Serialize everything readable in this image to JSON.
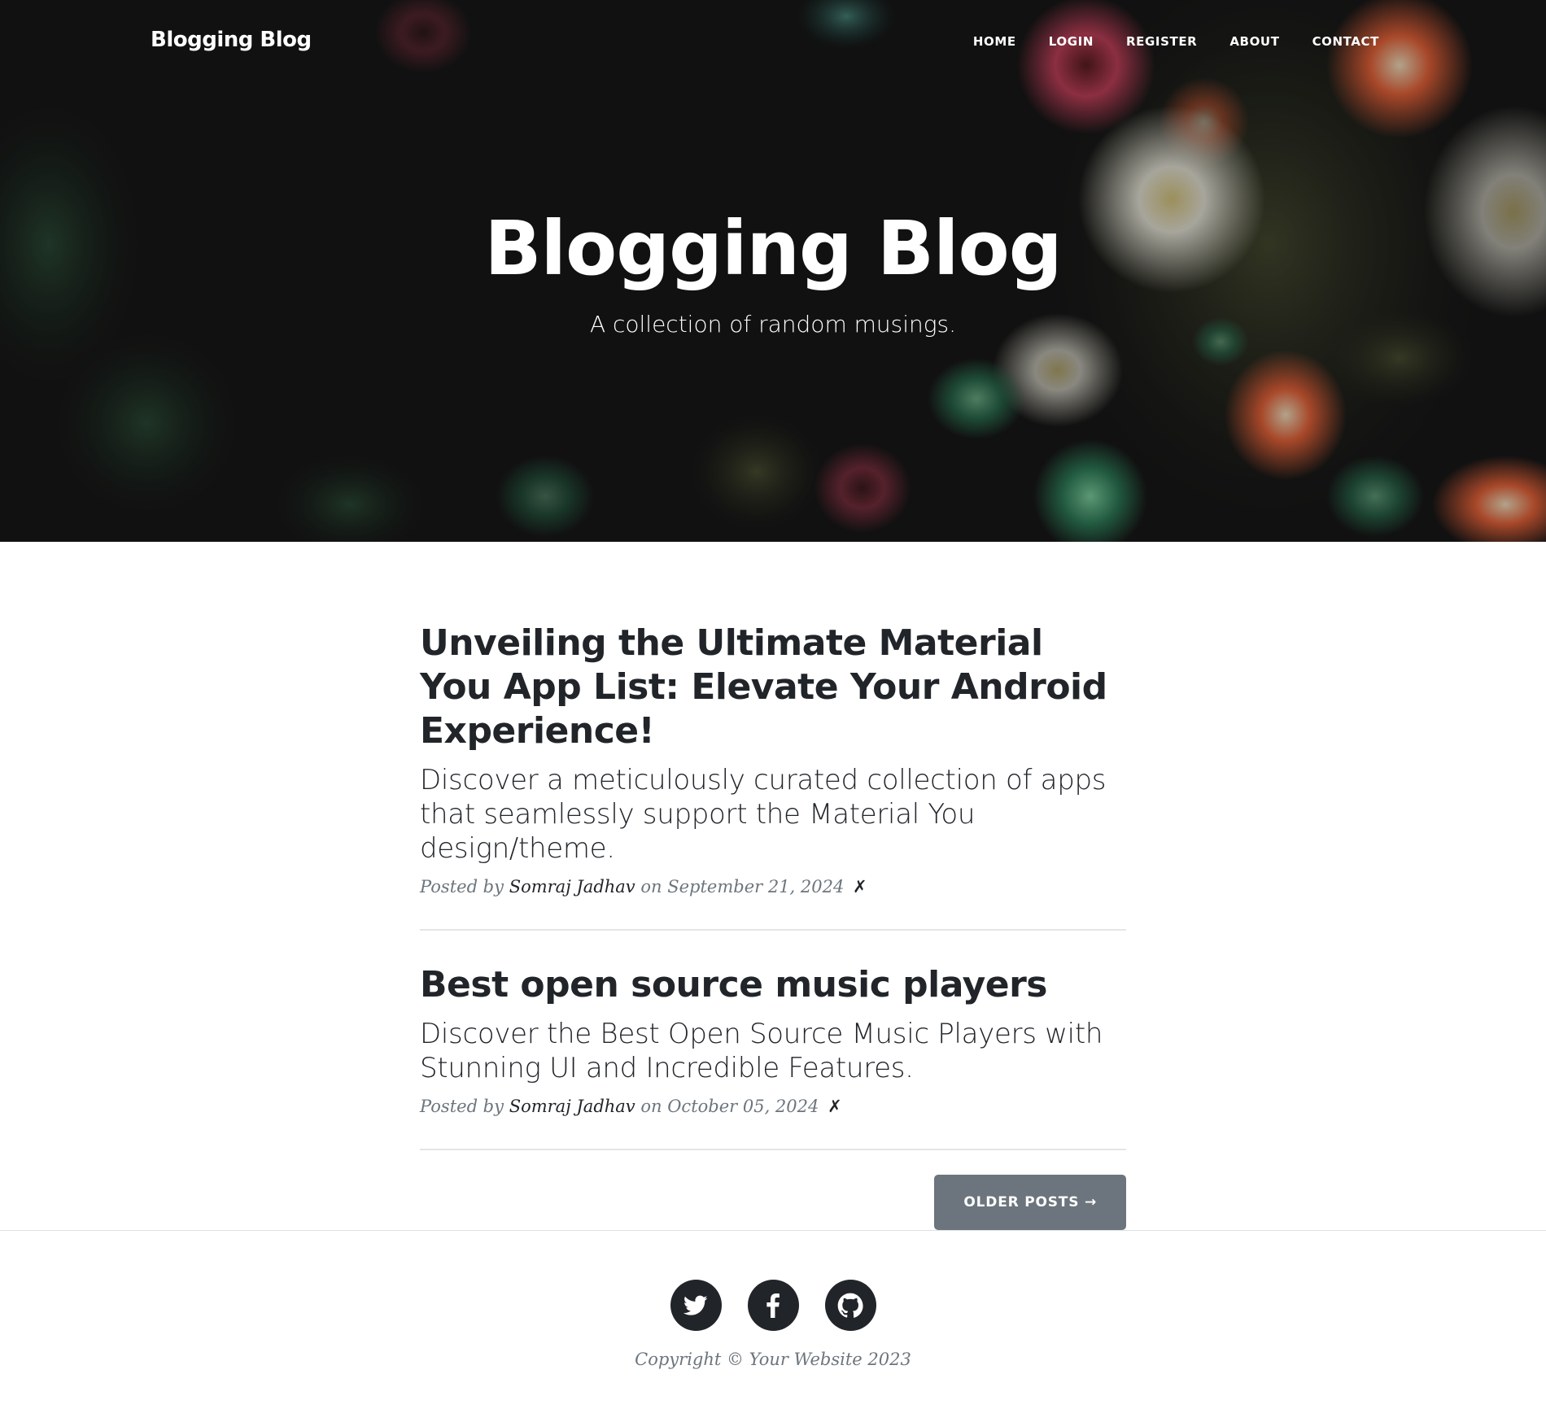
{
  "navbar": {
    "brand": "Blogging Blog",
    "links": [
      "Home",
      "Login",
      "Register",
      "About",
      "Contact"
    ]
  },
  "hero": {
    "heading": "Blogging Blog",
    "subheading": "A collection of random musings."
  },
  "posts": [
    {
      "title": "Unveiling the Ultimate Material You App List: Elevate Your Android Experience!",
      "subtitle": "Discover a meticulously curated collection of apps that seamlessly support the Material You design/theme.",
      "posted_by": "Posted by",
      "author": "Somraj Jadhav",
      "on": "on",
      "date": "September 21, 2024",
      "delete": "✗"
    },
    {
      "title": "Best open source music players",
      "subtitle": "Discover the Best Open Source Music Players with Stunning UI and Incredible Features.",
      "posted_by": "Posted by",
      "author": "Somraj Jadhav",
      "on": "on",
      "date": "October 05, 2024",
      "delete": "✗"
    }
  ],
  "pager": {
    "older_label": "Older Posts →"
  },
  "footer": {
    "social": [
      "twitter-icon",
      "facebook-icon",
      "github-icon"
    ],
    "copyright": "Copyright © Your Website 2023"
  },
  "colors": {
    "text_dark": "#212529",
    "text_muted": "#6c757d",
    "button_bg": "#6c757d",
    "hero_overlay": "#171717"
  }
}
